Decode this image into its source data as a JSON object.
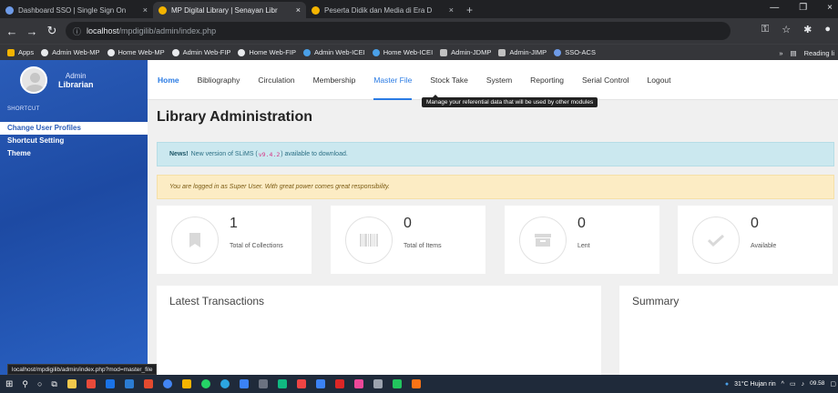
{
  "browser": {
    "tabs": [
      {
        "title": "Dashboard SSO | Single Sign On",
        "close": "×",
        "active": false,
        "color": "#6e9be8"
      },
      {
        "title": "MP Digital Library | Senayan Libr",
        "close": "×",
        "active": true,
        "color": "#f4b400"
      },
      {
        "title": "Peserta Didik dan Media di Era D",
        "close": "×",
        "active": false,
        "color": "#f4b400"
      }
    ],
    "new_tab": "+",
    "window_controls": [
      "—",
      "❐",
      "×"
    ],
    "url_host": "localhost",
    "url_path": "/mpdigilib/admin/index.php",
    "bookmarks": [
      {
        "label": "Apps",
        "color": "#f4b400"
      },
      {
        "label": "Admin Web-MP",
        "color": "#e8eaed"
      },
      {
        "label": "Home Web-MP",
        "color": "#e8eaed"
      },
      {
        "label": "Admin Web-FIP",
        "color": "#e8eaed"
      },
      {
        "label": "Home Web-FIP",
        "color": "#e8eaed"
      },
      {
        "label": "Admin Web-ICEI",
        "color": "#4aa0e8"
      },
      {
        "label": "Home Web-ICEI",
        "color": "#4aa0e8"
      },
      {
        "label": "Admin-JDMP",
        "color": "#c0c0c0"
      },
      {
        "label": "Admin-JIMP",
        "color": "#c0c0c0"
      },
      {
        "label": "SSO-ACS",
        "color": "#6e9be8"
      }
    ],
    "more_bookmarks": "»",
    "reading_list": "Reading li",
    "status_url": "localhost/mpdigilib/admin/index.php?mod=master_file"
  },
  "sidebar": {
    "role": "Admin",
    "level": "Librarian",
    "shortcut_header": "SHORTCUT",
    "items": [
      {
        "label": "Change User Profiles",
        "active": true
      },
      {
        "label": "Shortcut Setting",
        "active": false
      },
      {
        "label": "Theme",
        "active": false
      }
    ]
  },
  "topnav": {
    "items": [
      "Home",
      "Bibliography",
      "Circulation",
      "Membership",
      "Master File",
      "Stock Take",
      "System",
      "Reporting",
      "Serial Control",
      "Logout"
    ],
    "active": "Master File",
    "tooltip": "Manage your referential data that will be used by other modules"
  },
  "main": {
    "title": "Library Administration",
    "news_label": "News!",
    "news_pre": "New version of SLiMS (",
    "news_version": "v9.4.2",
    "news_post": ") available to download.",
    "warning": "You are logged in as Super User. With great power comes great responsibility.",
    "stats": [
      {
        "value": "1",
        "label": "Total of Collections",
        "icon": "bookmark-icon"
      },
      {
        "value": "0",
        "label": "Total of Items",
        "icon": "barcode-icon"
      },
      {
        "value": "0",
        "label": "Lent",
        "icon": "archive-icon"
      },
      {
        "value": "0",
        "label": "Available",
        "icon": "check-icon"
      }
    ],
    "panels": [
      "Latest Transactions",
      "Summary"
    ]
  },
  "taskbar": {
    "weather": "31°C  Hujan rin",
    "time": "09.58"
  }
}
